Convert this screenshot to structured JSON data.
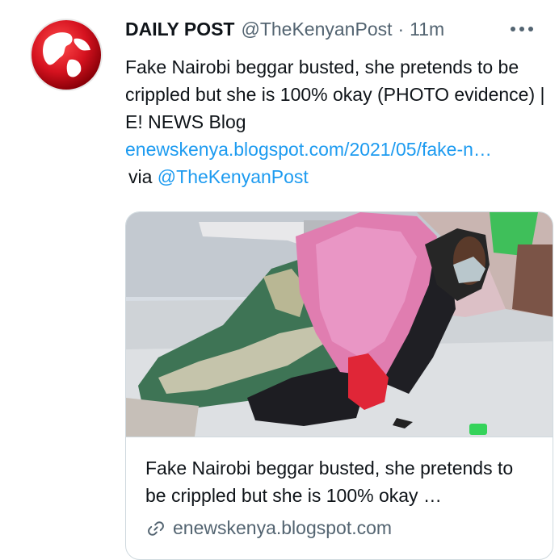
{
  "tweet": {
    "author_name": "DAILY POST",
    "handle": "@TheKenyanPost",
    "separator": "·",
    "time": "11m",
    "text": "Fake Nairobi beggar busted, she pretends to be crippled but she is 100% okay (PHOTO evidence) | E! NEWS Blog",
    "link": "enewskenya.blogspot.com/2021/05/fake-n…",
    "via_label": "via",
    "via_handle": "@TheKenyanPost"
  },
  "card": {
    "title": "Fake Nairobi beggar busted, she pretends to be crippled but she is 100% okay …",
    "domain": "enewskenya.blogspot.com"
  },
  "colors": {
    "link": "#1d9bf0",
    "secondary_text": "#536471",
    "avatar_red": "#d5121f"
  },
  "icons": [
    "globe-avatar-icon",
    "more-options-icon",
    "link-icon"
  ]
}
